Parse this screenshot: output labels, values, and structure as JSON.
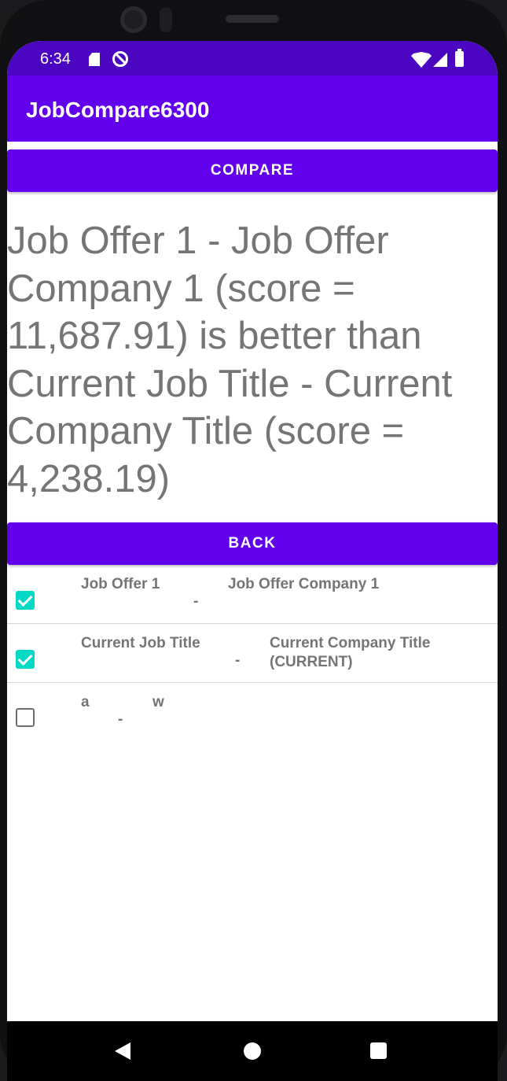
{
  "status_bar": {
    "time": "6:34",
    "icons": [
      "sd-card-icon",
      "do-not-disturb-icon",
      "wifi-icon",
      "signal-icon",
      "battery-icon"
    ]
  },
  "app_bar": {
    "title": "JobCompare6300"
  },
  "compare_button": {
    "label": "COMPARE"
  },
  "result_text": "Job Offer 1 - Job Offer Company 1 (score = 11,687.91) is better than Current Job Title - Current Company Title (score = 4,238.19)",
  "back_button": {
    "label": "BACK"
  },
  "jobs": [
    {
      "checked": true,
      "title": "Job Offer 1",
      "separator": "-",
      "company": "Job Offer Company 1"
    },
    {
      "checked": true,
      "title": "Current Job Title",
      "separator": "-",
      "company": "Current Company Title (CURRENT)"
    },
    {
      "checked": false,
      "title": "a",
      "separator": "-",
      "company": "w"
    }
  ],
  "colors": {
    "primary": "#6200ee",
    "status_bar": "#4b06c2",
    "checkbox_accent": "#03dac5",
    "text_secondary": "#757575"
  },
  "nav_bar": {
    "icons": [
      "back-icon",
      "home-icon",
      "recents-icon"
    ]
  }
}
